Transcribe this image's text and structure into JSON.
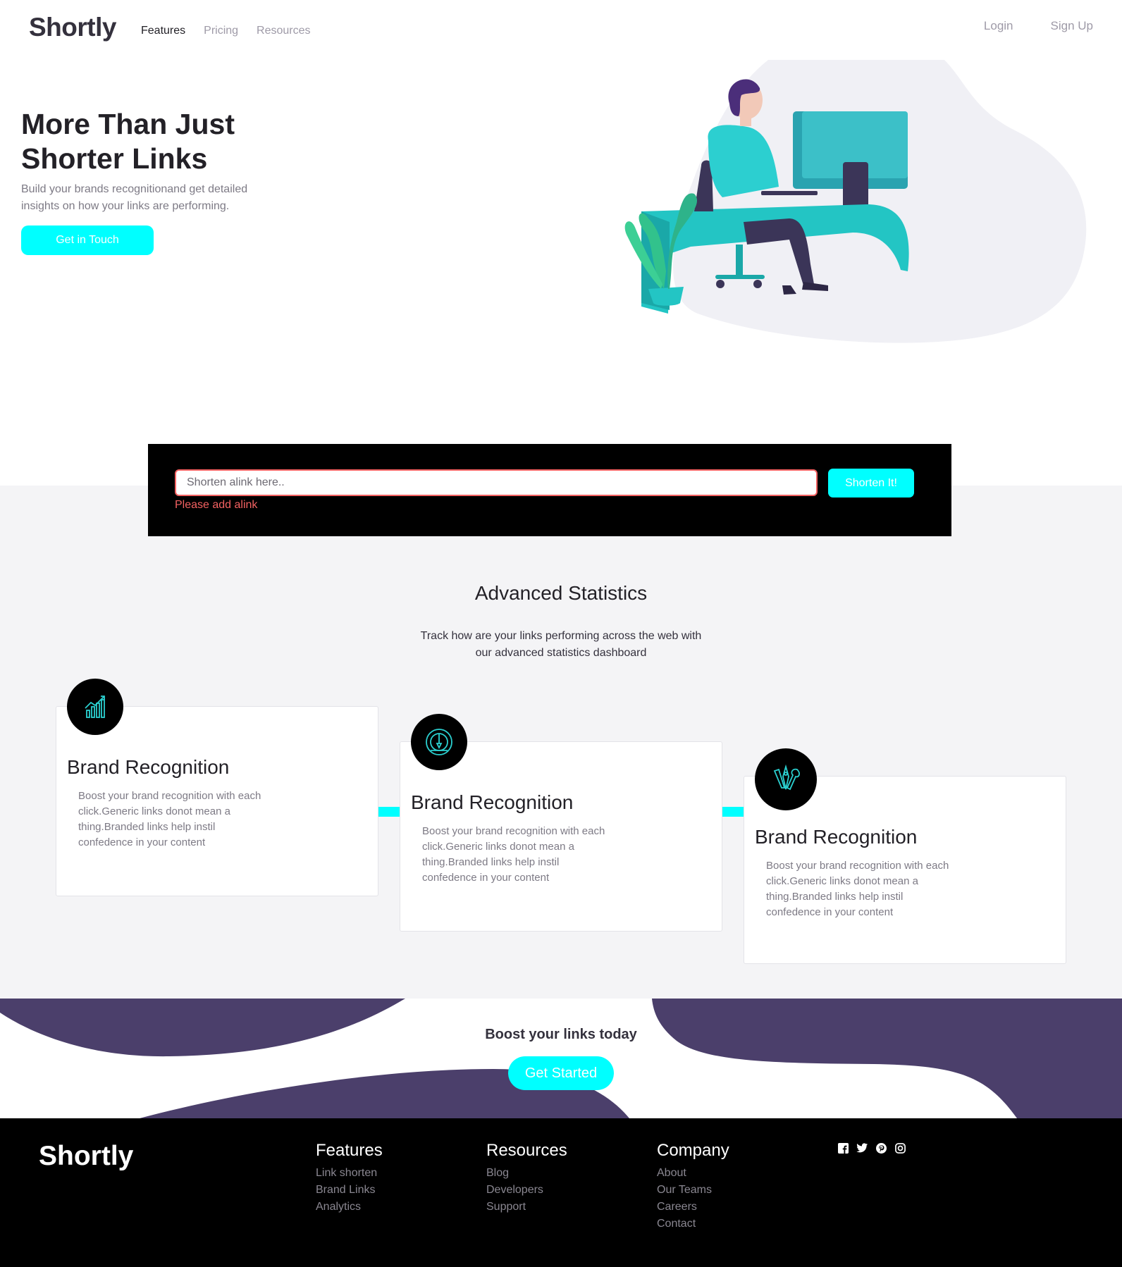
{
  "nav": {
    "logo": "Shortly",
    "links": [
      "Features",
      "Pricing",
      "Resources"
    ],
    "login": "Login",
    "signup": "Sign Up"
  },
  "hero": {
    "title_line1": "More Than Just",
    "title_line2": "Shorter Links",
    "subtitle": "Build your brands recognitionand get detailed insights on how your links are performing.",
    "cta": "Get in Touch"
  },
  "shorten": {
    "placeholder": "Shorten alink here..",
    "error": "Please add alink",
    "button": "Shorten It!"
  },
  "stats": {
    "title": "Advanced Statistics",
    "subtitle": "Track how are your links performing across the web with our advanced statistics dashboard",
    "cards": [
      {
        "icon": "chart-icon",
        "title": "Brand Recognition",
        "text": "Boost your brand recognition with each click.Generic links donot mean a thing.Branded links help instil confedence in your content"
      },
      {
        "icon": "gauge-icon",
        "title": "Brand Recognition",
        "text": "Boost your brand recognition with each click.Generic links donot mean a thing.Branded links help instil confedence in your content"
      },
      {
        "icon": "tools-icon",
        "title": "Brand Recognition",
        "text": "Boost your brand recognition with each click.Generic links donot mean a thing.Branded links help instil confedence in your content"
      }
    ]
  },
  "boost": {
    "title": "Boost your links today",
    "button": "Get Started"
  },
  "footer": {
    "logo": "Shortly",
    "columns": [
      {
        "title": "Features",
        "links": [
          "Link shorten",
          "Brand Links",
          "Analytics"
        ]
      },
      {
        "title": "Resources",
        "links": [
          "Blog",
          "Developers",
          "Support"
        ]
      },
      {
        "title": "Company",
        "links": [
          "About",
          "Our Teams",
          "Careers",
          "Contact"
        ]
      }
    ],
    "social": [
      "facebook-icon",
      "twitter-icon",
      "pinterest-icon",
      "instagram-icon"
    ]
  },
  "colors": {
    "accent": "#00ffff",
    "dark_violet": "#4b3f6b",
    "error": "#f46262",
    "text_dark": "#232127",
    "text_gray": "#9e9aa7"
  }
}
